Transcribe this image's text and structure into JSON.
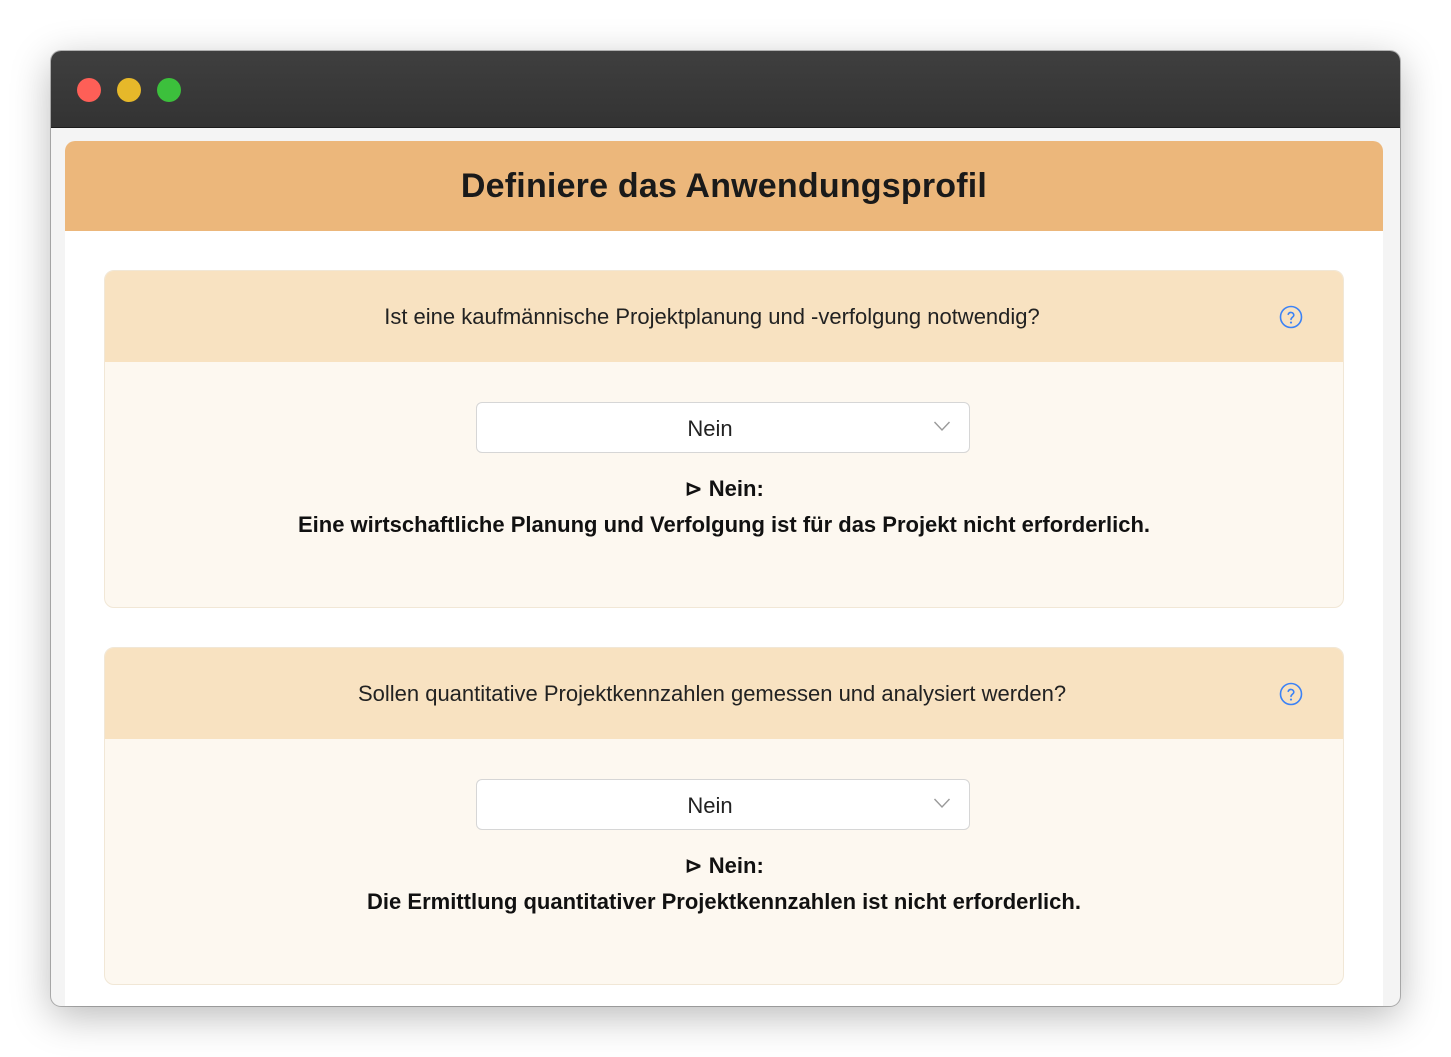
{
  "window": {
    "controls": [
      "close",
      "minimize",
      "maximize"
    ]
  },
  "page": {
    "title": "Definiere das Anwendungsprofil"
  },
  "questions": [
    {
      "question": "Ist eine kaufmännische Projektplanung und -verfolgung notwendig?",
      "help_icon": "question-circle-icon",
      "selected": "Nein",
      "answer_title": "⊳ Nein:",
      "answer_text": "Eine wirtschaftliche Planung und Verfolgung ist für das Projekt nicht erforderlich."
    },
    {
      "question": "Sollen quantitative Projektkennzahlen gemessen und analysiert werden?",
      "help_icon": "question-circle-icon",
      "selected": "Nein",
      "answer_title": "⊳ Nein:",
      "answer_text": "Die Ermittlung quantitativer Projektkennzahlen ist nicht erforderlich."
    }
  ],
  "colors": {
    "header": "#ecb77b",
    "card_head": "#f8e2c1",
    "card_body": "#fdf8f0",
    "help_icon": "#3b82f6"
  }
}
